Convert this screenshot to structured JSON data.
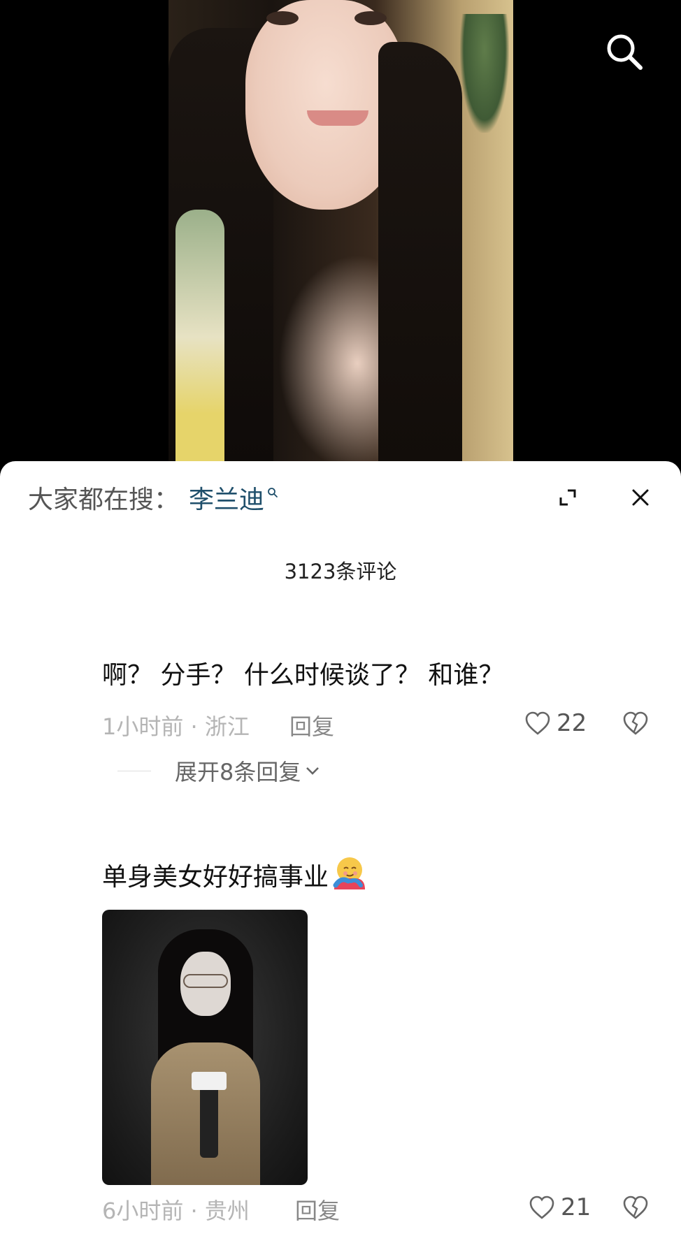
{
  "video": {
    "search_icon": "search-icon"
  },
  "comments_sheet": {
    "trending_label": "大家都在搜：",
    "trending_keyword": "李兰迪",
    "comment_count": "3123条评论",
    "expand_icon": "expand-icon",
    "close_icon": "close-icon"
  },
  "comments": [
    {
      "text": "啊？ 分手？ 什么时候谈了？ 和谁？",
      "time_location": "1小时前 · 浙江",
      "reply_label": "回复",
      "likes": "22",
      "expand_replies": "展开8条回复"
    },
    {
      "text": "单身美女好好搞事业",
      "emoji": "hugging-face-emoji",
      "time_location": "6小时前 · 贵州",
      "reply_label": "回复",
      "likes": "21"
    }
  ],
  "colors": {
    "keyword": "#1f4f6b",
    "meta": "#b5b5b5",
    "sheet_bg": "#ffffff",
    "video_bg": "#000000"
  }
}
